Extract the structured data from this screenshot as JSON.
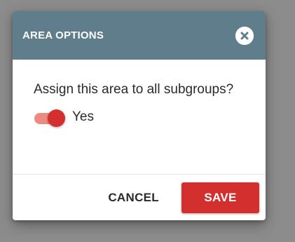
{
  "dialog": {
    "title": "AREA OPTIONS",
    "close_icon": "close-circle-icon",
    "question": "Assign this area to all subgroups?",
    "toggle": {
      "label": "Yes",
      "checked": true
    },
    "buttons": {
      "cancel_label": "CANCEL",
      "save_label": "SAVE"
    }
  },
  "colors": {
    "header": "#607d8b",
    "accent": "#d32f2f",
    "toggle_track": "#ee8b80",
    "backdrop": "#8c8c8c"
  }
}
